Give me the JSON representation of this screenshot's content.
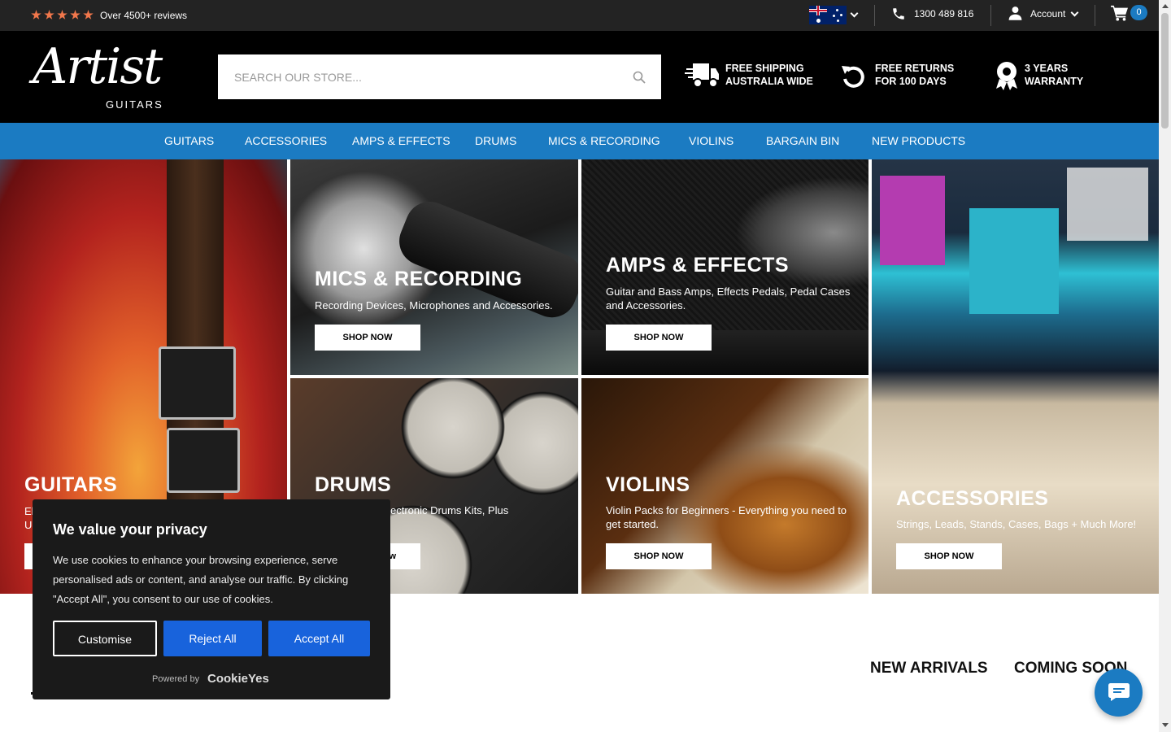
{
  "topbar": {
    "reviews": "Over 4500+ reviews",
    "phone": "1300 489 816",
    "account": "Account",
    "cart_count": "0"
  },
  "header": {
    "logo_text": "Artist",
    "logo_sub": "GUITARS",
    "search_placeholder": "SEARCH OUR STORE...",
    "usps": [
      {
        "line1": "FREE SHIPPING",
        "line2": "AUSTRALIA WIDE",
        "icon": "truck-icon"
      },
      {
        "line1": "FREE RETURNS",
        "line2": "FOR 100 DAYS",
        "icon": "return-icon"
      },
      {
        "line1": "3 YEARS",
        "line2": "WARRANTY",
        "icon": "award-icon"
      }
    ]
  },
  "nav": [
    "GUITARS",
    "ACCESSORIES",
    "AMPS & EFFECTS",
    "DRUMS",
    "MICS & RECORDING",
    "VIOLINS",
    "BARGAIN BIN",
    "NEW PRODUCTS"
  ],
  "tiles": {
    "guitars": {
      "title": "GUITARS",
      "desc": "El",
      "desc2": "U"
    },
    "mics": {
      "title": "MICS & RECORDING",
      "desc": "Recording Devices, Microphones and Accessories.",
      "button": "SHOP NOW"
    },
    "amps": {
      "title": "AMPS & EFFECTS",
      "desc": "Guitar and Bass Amps, Effects Pedals, Pedal Cases and Accessories.",
      "button": "SHOP NOW"
    },
    "drums": {
      "title": "DRUMS",
      "desc": "ectronic Drums Kits, Plus",
      "button": "w"
    },
    "violins": {
      "title": "VIOLINS",
      "desc": "Violin Packs for Beginners - Everything you need to get started.",
      "button": "SHOP NOW"
    },
    "accessories": {
      "title": "ACCESSORIES",
      "desc": "Strings, Leads, Stands, Cases, Bags + Much More!",
      "button": "SHOP NOW"
    }
  },
  "tabs": {
    "new_arrivals": "NEW ARRIVALS",
    "coming_soon": "COMING SOON"
  },
  "cookie": {
    "title": "We value your privacy",
    "body": "We use cookies to enhance your browsing experience, serve personalised ads or content, and analyse our traffic. By clicking \"Accept All\", you consent to our use of cookies.",
    "customise": "Customise",
    "reject": "Reject All",
    "accept": "Accept All",
    "powered": "Powered by",
    "brand": "CookieYes"
  },
  "colors": {
    "brand_blue": "#1b7bc2",
    "star_orange": "#f2774b",
    "cookie_btn": "#1863dc"
  }
}
